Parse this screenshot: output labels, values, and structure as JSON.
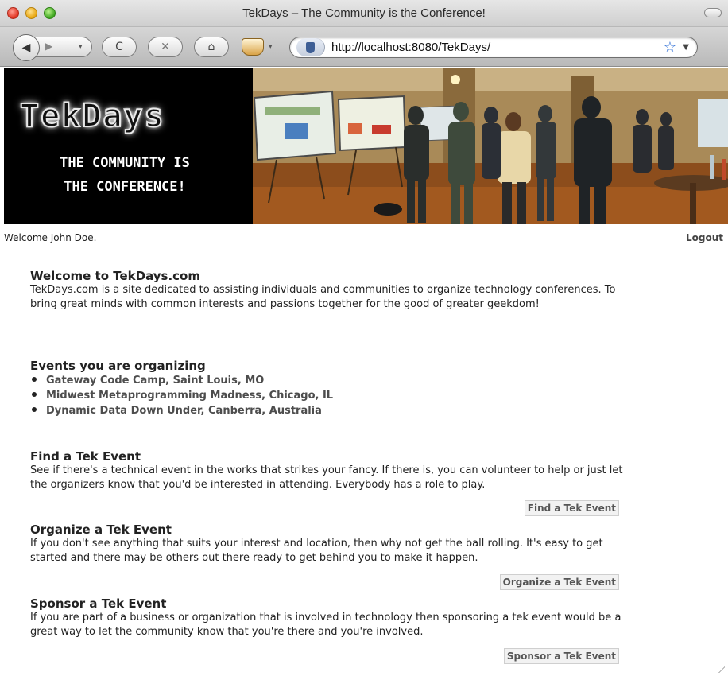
{
  "window": {
    "title": "TekDays – The Community is the Conference!"
  },
  "toolbar": {
    "back_icon": "◀",
    "forward_icon": "▶",
    "reload_icon": "C",
    "stop_icon": "✕",
    "home_icon": "⌂",
    "url": "http://localhost:8080/TekDays/",
    "bookmark_icon": "☆"
  },
  "banner": {
    "logo": "TekDays",
    "tagline_line1": "THE COMMUNITY IS",
    "tagline_line2": "THE CONFERENCE!"
  },
  "user_bar": {
    "welcome": "Welcome John Doe.",
    "logout": "Logout"
  },
  "intro": {
    "heading": "Welcome to TekDays.com",
    "body": "TekDays.com is a site dedicated to assisting individuals and communities to organize technology conferences. To bring great minds with common interests and passions together for the good of greater geekdom!"
  },
  "organizing": {
    "heading": "Events you are organizing",
    "events": [
      "Gateway Code Camp, Saint Louis, MO",
      "Midwest Metaprogramming Madness, Chicago, IL",
      "Dynamic Data Down Under, Canberra, Australia"
    ]
  },
  "find": {
    "heading": "Find a Tek Event",
    "body": "See if there's a technical event in the works that strikes your fancy. If there is, you can volunteer to help or just let the organizers know that you'd be interested in attending. Everybody has a role to play.",
    "button": "Find a Tek Event"
  },
  "organize": {
    "heading": "Organize a Tek Event",
    "body": "If you don't see anything that suits your interest and location, then why not get the ball rolling. It's easy to get started and there may be others out there ready to get behind you to make it happen.",
    "button": "Organize a Tek Event"
  },
  "sponsor": {
    "heading": "Sponsor a Tek Event",
    "body": "If you are part of a business or organization that is involved in technology then sponsoring a tek event would be a great way to let the community know that you're there and you're involved.",
    "button": "Sponsor a Tek Event"
  }
}
